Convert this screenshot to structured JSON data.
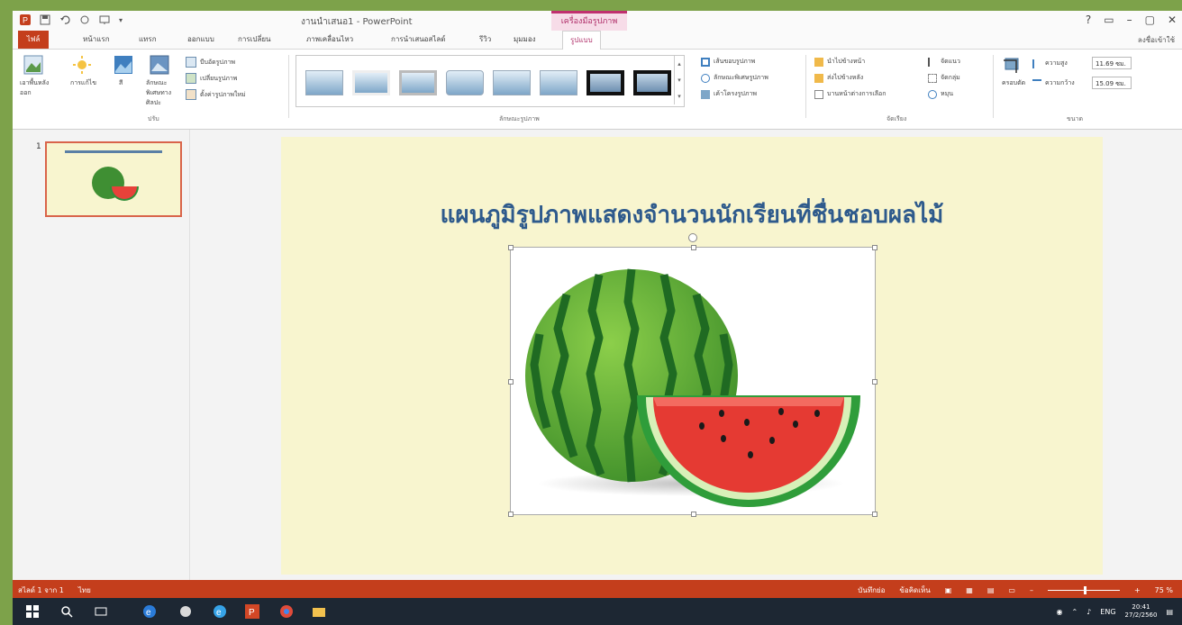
{
  "window": {
    "title": "งานนำเสนอ1 - PowerPoint",
    "contextual_tab_title": "เครื่องมือรูปภาพ",
    "window_controls": [
      "?",
      "▢",
      "–",
      "▢",
      "✕"
    ],
    "sign_in": "ลงชื่อเข้าใช้"
  },
  "ribbon_tabs": [
    {
      "label": "ไฟล์"
    },
    {
      "label": "หน้าแรก"
    },
    {
      "label": "แทรก"
    },
    {
      "label": "ออกแบบ"
    },
    {
      "label": "การเปลี่ยน"
    },
    {
      "label": "ภาพเคลื่อนไหว"
    },
    {
      "label": "การนำเสนอสไลด์"
    },
    {
      "label": "รีวิว"
    },
    {
      "label": "มุมมอง"
    },
    {
      "label": "รูปแบบ"
    }
  ],
  "ribbon": {
    "adjust": {
      "remove_bg": "เอาพื้นหลังออก",
      "corrections": "การแก้ไข",
      "color": "สี",
      "artistic": "ลักษณะพิเศษทางศิลปะ",
      "compress": "บีบอัดรูปภาพ",
      "change": "เปลี่ยนรูปภาพ",
      "reset": "ตั้งค่ารูปภาพใหม่",
      "group_label": "ปรับ"
    },
    "styles": {
      "border": "เส้นขอบรูปภาพ",
      "effects": "ลักษณะพิเศษรูปภาพ",
      "layout": "เค้าโครงรูปภาพ",
      "group_label": "ลักษณะรูปภาพ"
    },
    "arrange": {
      "bring_forward": "นำไปข้างหน้า",
      "send_backward": "ส่งไปข้างหลัง",
      "selection_pane": "บานหน้าต่างการเลือก",
      "align": "จัดแนว",
      "group": "จัดกลุ่ม",
      "rotate": "หมุน",
      "group_label": "จัดเรียง"
    },
    "size": {
      "crop": "ครอบตัด",
      "height_label": "ความสูง",
      "height_value": "11.69 ซม.",
      "width_label": "ความกว้าง",
      "width_value": "15.09 ซม.",
      "group_label": "ขนาด"
    }
  },
  "thumbnails": [
    {
      "number": "1"
    }
  ],
  "slide": {
    "title": "แผนภูมิรูปภาพแสดงจำนวนนักเรียนที่ชื่นชอบผลไม้"
  },
  "status": {
    "slide_info": "สไลด์ 1 จาก 1",
    "language": "ไทย",
    "notes": "บันทึกย่อ",
    "comments": "ข้อคิดเห็น",
    "zoom": "75 %"
  },
  "taskbar": {
    "lang": "ENG",
    "time": "20:41",
    "date": "27/2/2560"
  },
  "colors": {
    "accent_red": "#c43e1c",
    "title_blue": "#2e5a8c",
    "slide_bg": "#f8f5cf",
    "frame_green": "#7da24a"
  }
}
